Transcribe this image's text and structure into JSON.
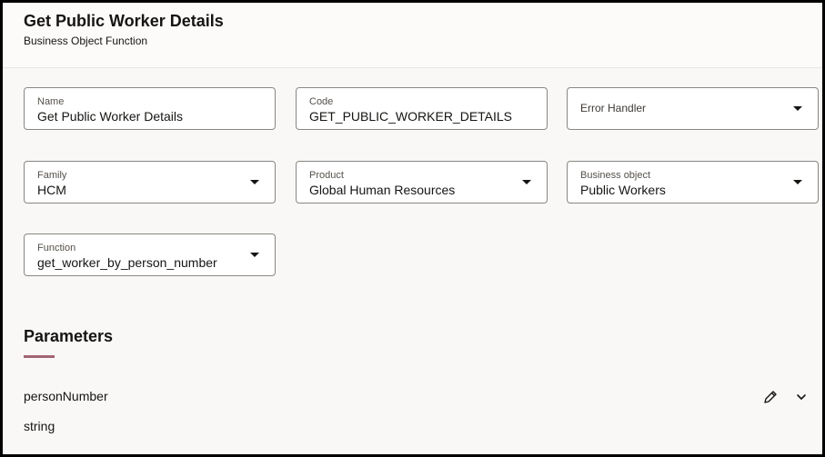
{
  "header": {
    "title": "Get Public Worker Details",
    "subtitle": "Business Object Function"
  },
  "form": {
    "name": {
      "label": "Name",
      "value": "Get Public Worker Details"
    },
    "code": {
      "label": "Code",
      "value": "GET_PUBLIC_WORKER_DETAILS"
    },
    "error_handler": {
      "label": "Error Handler",
      "value": ""
    },
    "family": {
      "label": "Family",
      "value": "HCM"
    },
    "product": {
      "label": "Product",
      "value": "Global Human Resources"
    },
    "business_object": {
      "label": "Business object",
      "value": "Public Workers"
    },
    "function": {
      "label": "Function",
      "value": "get_worker_by_person_number"
    }
  },
  "parameters": {
    "title": "Parameters",
    "accent_color": "#a36472",
    "items": [
      {
        "name": "personNumber",
        "type": "string",
        "icons": [
          "pencil-icon",
          "chevron-down-icon"
        ]
      }
    ]
  }
}
